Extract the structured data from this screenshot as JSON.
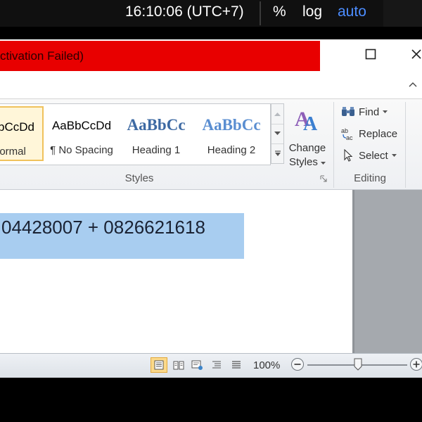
{
  "taskbar": {
    "clock": "16:10:06 (UTC+7)",
    "percent": "%",
    "log": "log",
    "auto": "auto"
  },
  "window": {
    "title_fragment": "ctivation Failed)",
    "title_color": "#e80000"
  },
  "ribbon": {
    "styles_group": {
      "label": "Styles",
      "items": [
        {
          "sample": "bCcDd",
          "name": "lormal"
        },
        {
          "sample": "AaBbCcDd",
          "name": "¶ No Spacing"
        },
        {
          "sample": "AaBbCc",
          "name": "Heading 1"
        },
        {
          "sample": "AaBbCc",
          "name": "Heading 2"
        }
      ],
      "change_styles": {
        "line1": "Change",
        "line2": "Styles"
      }
    },
    "editing_group": {
      "label": "Editing",
      "find": "Find",
      "replace": "Replace",
      "select": "Select"
    }
  },
  "document": {
    "text": "04428007 + 0826621618",
    "highlight_color": "#a8cdf0"
  },
  "statusbar": {
    "zoom_percent": "100%",
    "zoom_level": 100
  }
}
